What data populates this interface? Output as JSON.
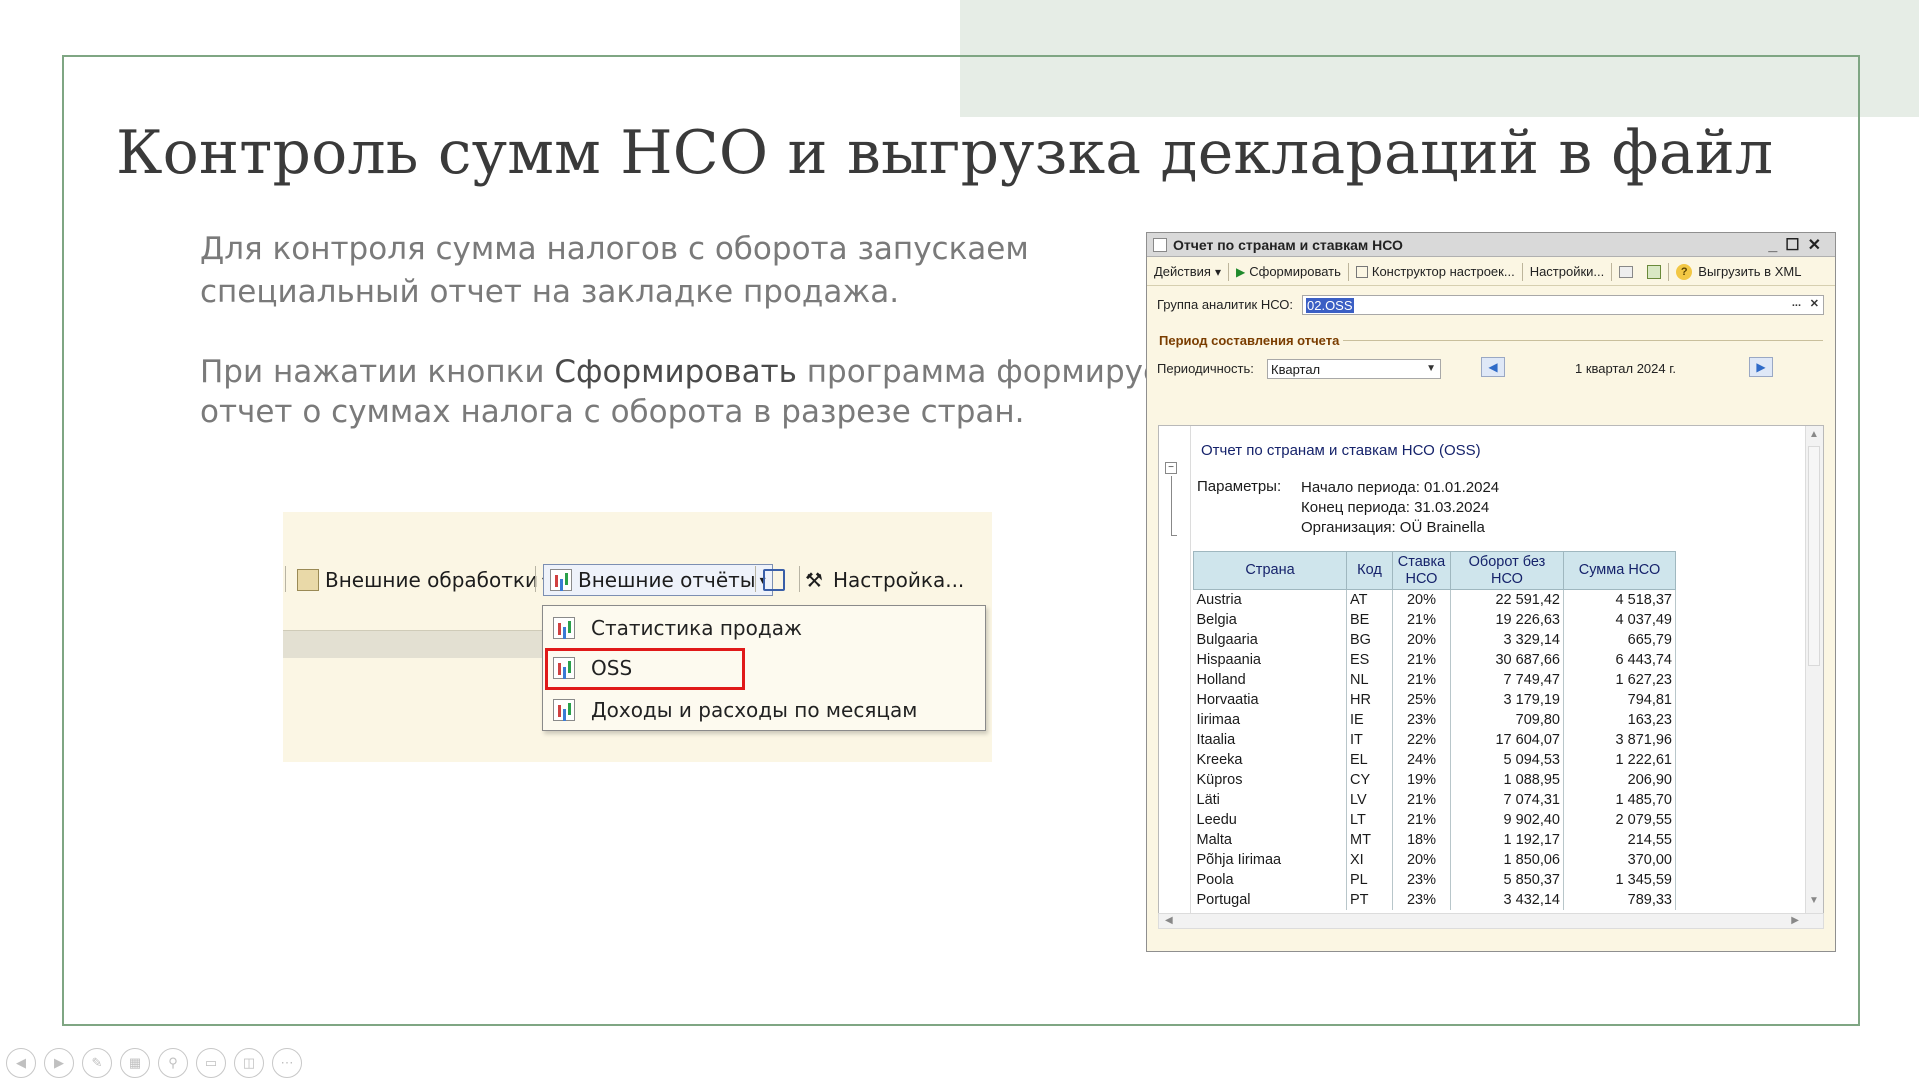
{
  "slide": {
    "title": "Контроль сумм НСО и выгрузка деклараций в файл",
    "para1_line1": "Для контроля сумма налогов с оборота запускаем",
    "para1_line2": "специальный отчет на закладке продажа.",
    "para2_before": "При нажатии кнопки ",
    "para2_button": "Сформировать",
    "para2_after": " программа формирует",
    "para2_line2": "отчет о суммах налога с оборота в разрезе стран.",
    "accent_color": "#e6ede6",
    "frame_color": "#7fa683"
  },
  "toolbar_shot": {
    "ext_processing": "Внешние обработки",
    "ext_reports": "Внешние отчёты",
    "settings": "Настройка...",
    "menu": [
      "Статистика продаж",
      "OSS",
      "Доходы и расходы по месяцам"
    ],
    "highlight_color": "#e01919"
  },
  "report_window": {
    "title": "Отчет по странам и ставкам НСО",
    "toolbar": {
      "actions": "Действия",
      "generate": "Сформировать",
      "constructor": "Конструктор настроек...",
      "settings": "Настройки...",
      "export_xml": "Выгрузить в XML"
    },
    "group_label": "Группа аналитик НСО:",
    "group_value": "02.OSS",
    "section_title": "Период составления отчета",
    "period_label": "Периодичность:",
    "period_value": "Квартал",
    "period_display": "1 квартал 2024 г.",
    "report_title": "Отчет по странам и ставкам НСО (OSS)",
    "params_label": "Параметры:",
    "param_start": "Начало периода: 01.01.2024",
    "param_end": "Конец периода: 31.03.2024",
    "param_org": "Организация: OÜ Brainella",
    "columns": {
      "country": "Страна",
      "code": "Код",
      "rate": "Ставка НСО",
      "turnover": "Оборот без НСО",
      "tax": "Сумма НСО"
    },
    "rows": [
      [
        "Austria",
        "AT",
        "20%",
        "22 591,42",
        "4 518,37"
      ],
      [
        "Belgia",
        "BE",
        "21%",
        "19 226,63",
        "4 037,49"
      ],
      [
        "Bulgaaria",
        "BG",
        "20%",
        "3 329,14",
        "665,79"
      ],
      [
        "Hispaania",
        "ES",
        "21%",
        "30 687,66",
        "6 443,74"
      ],
      [
        "Holland",
        "NL",
        "21%",
        "7 749,47",
        "1 627,23"
      ],
      [
        "Horvaatia",
        "HR",
        "25%",
        "3 179,19",
        "794,81"
      ],
      [
        "Iirimaa",
        "IE",
        "23%",
        "709,80",
        "163,23"
      ],
      [
        "Itaalia",
        "IT",
        "22%",
        "17 604,07",
        "3 871,96"
      ],
      [
        "Kreeka",
        "EL",
        "24%",
        "5 094,53",
        "1 222,61"
      ],
      [
        "Küpros",
        "CY",
        "19%",
        "1 088,95",
        "206,90"
      ],
      [
        "Läti",
        "LV",
        "21%",
        "7 074,31",
        "1 485,70"
      ],
      [
        "Leedu",
        "LT",
        "21%",
        "9 902,40",
        "2 079,55"
      ],
      [
        "Malta",
        "MT",
        "18%",
        "1 192,17",
        "214,55"
      ],
      [
        "Põhja Iirimaa",
        "XI",
        "20%",
        "1 850,06",
        "370,00"
      ],
      [
        "Poola",
        "PL",
        "23%",
        "5 850,37",
        "1 345,59"
      ],
      [
        "Portugal",
        "PT",
        "23%",
        "3 432,14",
        "789,33"
      ]
    ]
  },
  "nav_icons": [
    "prev-icon",
    "next-icon",
    "pen-icon",
    "slides-icon",
    "zoom-icon",
    "subtitles-icon",
    "camera-off-icon",
    "more-icon"
  ]
}
